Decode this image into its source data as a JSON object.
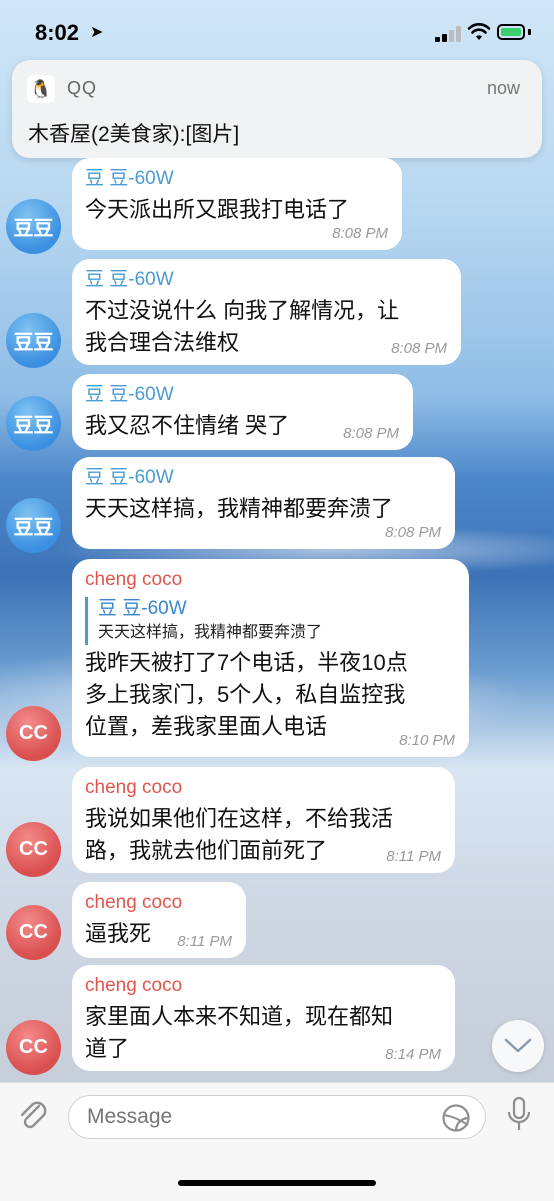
{
  "status_bar": {
    "time": "8:02"
  },
  "notification": {
    "app": "QQ",
    "time": "now",
    "body": "木香屋(2美食家):[图片]"
  },
  "messages": [
    {
      "sender": "豆 豆-60W",
      "avatar": "豆豆",
      "text": "今天派出所又跟我打电话了",
      "time": "8:08 PM"
    },
    {
      "sender": "豆 豆-60W",
      "avatar": "豆豆",
      "text_lines": [
        "不过没说什么 向我了解情况，让",
        "我合理合法维权"
      ],
      "time": "8:08 PM"
    },
    {
      "sender": "豆 豆-60W",
      "avatar": "豆豆",
      "text": "我又忍不住情绪 哭了",
      "time": "8:08 PM"
    },
    {
      "sender": "豆 豆-60W",
      "avatar": "豆豆",
      "text": "天天这样搞，我精神都要奔溃了",
      "time": "8:08 PM"
    },
    {
      "sender": "cheng coco",
      "avatar": "CC",
      "quote_name": "豆 豆-60W",
      "quote_text": "天天这样搞，我精神都要奔溃了",
      "text_lines": [
        "我昨天被打了7个电话，半夜10点",
        "多上我家门，5个人，私自监控我",
        "位置，差我家里面人电话"
      ],
      "time": "8:10 PM"
    },
    {
      "sender": "cheng coco",
      "avatar": "CC",
      "text_lines": [
        "我说如果他们在这样，不给我活",
        "路，我就去他们面前死了"
      ],
      "time": "8:11 PM"
    },
    {
      "sender": "cheng coco",
      "avatar": "CC",
      "text": "逼我死",
      "time": "8:11 PM"
    },
    {
      "sender": "cheng coco",
      "avatar": "CC",
      "text_lines": [
        "家里面人本来不知道，现在都知",
        "道了"
      ],
      "time": "8:14 PM"
    }
  ],
  "input": {
    "placeholder": "Message"
  },
  "icons": {
    "navigation": "location-arrow-icon",
    "attach": "paperclip-icon",
    "sticker": "sticker-icon",
    "mic": "microphone-icon",
    "scroll": "chevron-down-icon"
  },
  "colors": {
    "sender_blue": "#4a9bd3",
    "sender_red": "#e1564c",
    "battery": "#3bd16f"
  }
}
